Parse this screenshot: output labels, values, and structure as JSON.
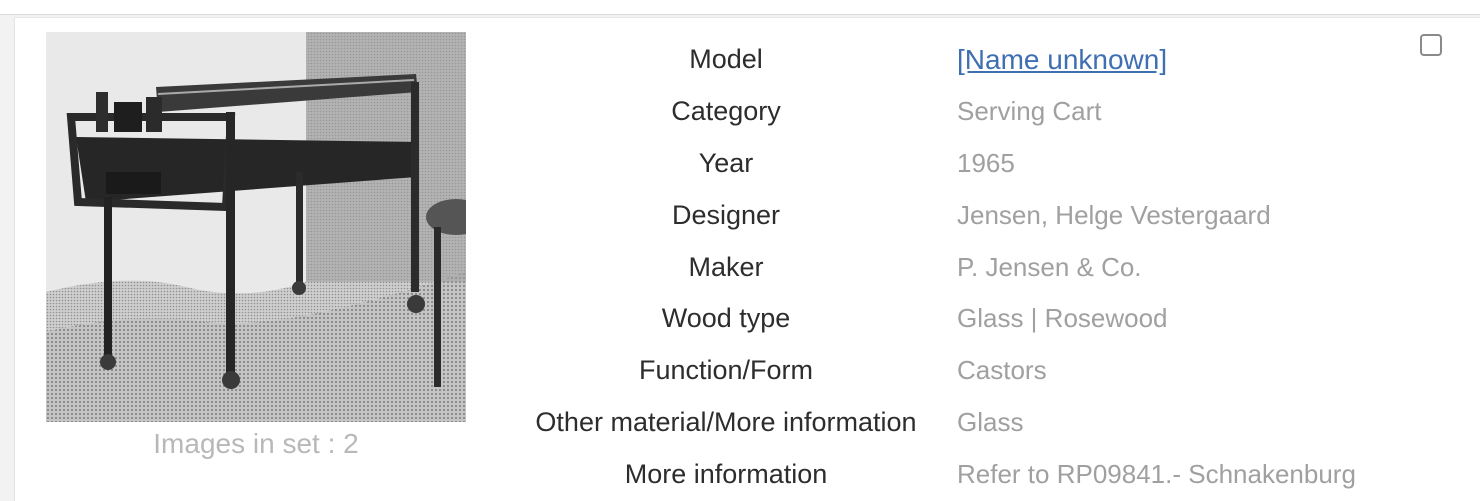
{
  "record": {
    "images_in_set": "Images in set : 2",
    "fields": [
      {
        "label": "Model",
        "value": "[Name unknown]"
      },
      {
        "label": "Category",
        "value": "Serving Cart"
      },
      {
        "label": "Year",
        "value": "1965"
      },
      {
        "label": "Designer",
        "value": "Jensen, Helge Vestergaard"
      },
      {
        "label": "Maker",
        "value": "P. Jensen & Co."
      },
      {
        "label": "Wood type",
        "value": "Glass | Rosewood"
      },
      {
        "label": "Function/Form",
        "value": "Castors"
      },
      {
        "label": "Other material/More information",
        "value": "Glass"
      },
      {
        "label": "More information",
        "value": "Refer to RP09841.- Schnakenburg"
      }
    ],
    "checkbox_checked": false
  },
  "colors": {
    "link": "#3f6fb3",
    "label": "#2d2d2d",
    "value": "#a0a0a0"
  }
}
